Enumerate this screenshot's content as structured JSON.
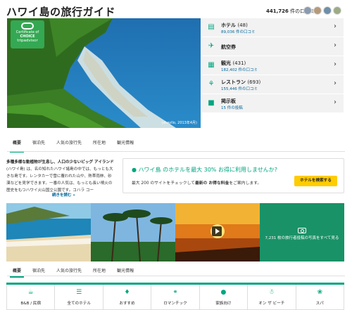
{
  "header": {
    "title": "ハワイ島の旅行ガイド",
    "review_count": "441,726",
    "review_suffix": "件の口コミ"
  },
  "hero": {
    "badge": {
      "line1": "Certificate of",
      "line2": "CHOICE",
      "line3": "tripadvisor"
    },
    "credit": "(shayllo, 2013年4月)"
  },
  "categories": [
    {
      "icon": "bed-icon",
      "label": "ホテル",
      "count": "(48)",
      "sub": "89,036 件の口コミ"
    },
    {
      "icon": "plane-icon",
      "label": "航空券",
      "count": "",
      "sub": ""
    },
    {
      "icon": "ticket-icon",
      "label": "観光",
      "count": "(431)",
      "sub": "182,402 件の口コミ"
    },
    {
      "icon": "fork-knife-icon",
      "label": "レストラン",
      "count": "(693)",
      "sub": "155,446 件の口コミ"
    },
    {
      "icon": "chat-icon",
      "label": "掲示板",
      "count": "",
      "sub": "15 件の投稿"
    }
  ],
  "tabs": [
    "概要",
    "宿泊先",
    "人気の旅行先",
    "所在地",
    "観光情報"
  ],
  "description": {
    "bold": "多種多様な動植物が生息し、人口の少ないビッグ アイランド",
    "text": " (ハワイ島) は、名の知れたハワイ諸島の中では、もっとも大きな島です。レンタカーで雪に覆われた山や、熱帯雨林、砂漠などを見学できます。一番の人気は、もっとも長い噴火の歴史をもつハワイ火山国立公園です。コハラ コー",
    "read_more": "続きを読む »"
  },
  "promo": {
    "title": "ハワイ島 のホテルを最大 30% お得に利用しませんか?",
    "sub_pre": "最大 200 のサイトをチェックして",
    "sub_bold": "最新の お得な料金",
    "sub_post": "をご案内します。",
    "button": "ホテルを検索する"
  },
  "photos": {
    "count_text": "7,231 枚の旅行者投稿の写真をすべて見る"
  },
  "bottom_bar": [
    {
      "icon": "coffee-icon",
      "label": "B&B / 民宿"
    },
    {
      "icon": "list-icon",
      "label": "全てのホテル"
    },
    {
      "icon": "tag-icon",
      "label": "おすすめ"
    },
    {
      "icon": "rings-icon",
      "label": "ロマンチック"
    },
    {
      "icon": "family-icon",
      "label": "家族向け"
    },
    {
      "icon": "palm-icon",
      "label": "オン ザ ビーチ"
    },
    {
      "icon": "lotus-icon",
      "label": "スパ"
    }
  ],
  "colors": {
    "accent": "#00a680",
    "button": "#ffcc00",
    "link": "#006699"
  }
}
